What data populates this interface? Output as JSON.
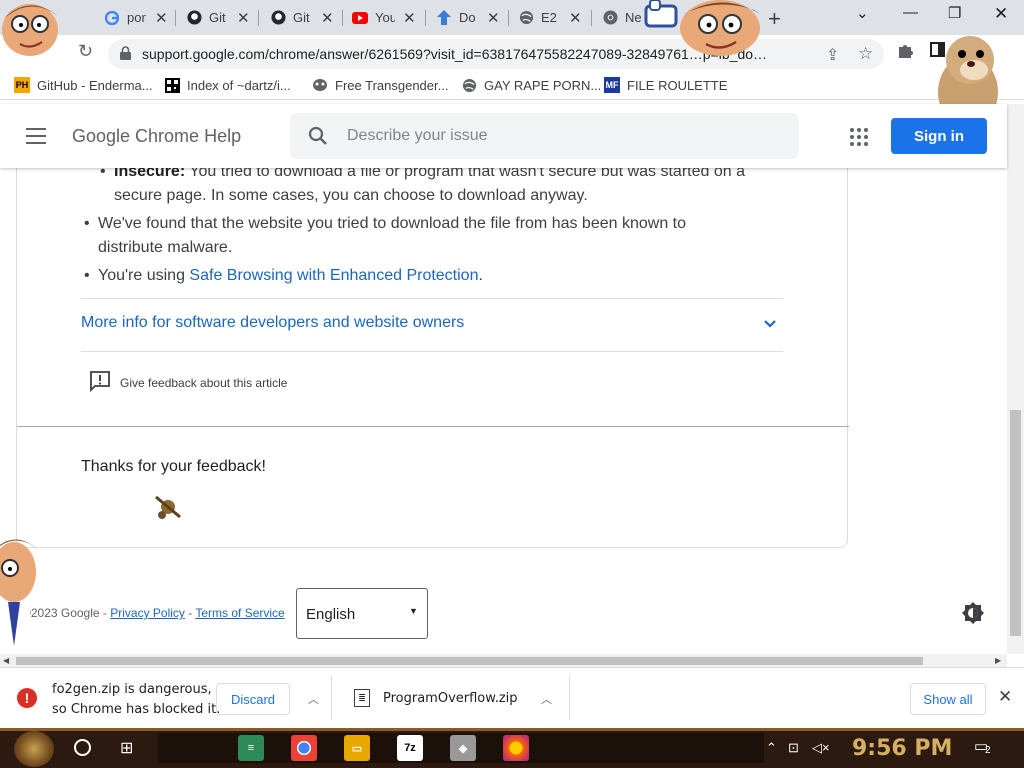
{
  "tabs": [
    {
      "title": "por",
      "favicon": "google-icon"
    },
    {
      "title": "Git",
      "favicon": "github-icon"
    },
    {
      "title": "Git",
      "favicon": "github-icon"
    },
    {
      "title": "You",
      "favicon": "youtube-icon"
    },
    {
      "title": "Do",
      "favicon": "download-arrow-icon"
    },
    {
      "title": "E2",
      "favicon": "globe-icon"
    },
    {
      "title": "Ne",
      "favicon": "chrome-icon"
    }
  ],
  "omnibox": {
    "url": "support.google.com/chrome/answer/6261569?visit_id=638176475582247089-32849761…p=ib_do…"
  },
  "bookmarks": [
    {
      "label": "GitHub - Enderma...",
      "favicon": "PH"
    },
    {
      "label": "Index of ~dartz/i...",
      "favicon": "qr"
    },
    {
      "label": "Free Transgender...",
      "favicon": "mask"
    },
    {
      "label": "GAY RAPE PORN...",
      "favicon": "globe"
    },
    {
      "label": "FILE ROULETTE",
      "favicon": "MF"
    }
  ],
  "help": {
    "title": "Google Chrome Help",
    "search_placeholder": "Describe your issue",
    "signin": "Sign in"
  },
  "article": {
    "insecure_label": "Insecure:",
    "insecure_text": " You tried to download a file or program that wasn't secure but was started on a",
    "insecure_text2": "secure page. In some cases, you can choose to download anyway.",
    "malware_line1": "We've found that the website you tried to download the file from has been known to",
    "malware_line2": "distribute malware.",
    "safe_prefix": "You're using ",
    "safe_link": "Safe Browsing with Enhanced Protection",
    "safe_suffix": ".",
    "more_info": "More info for software developers and website owners",
    "feedback": "Give feedback about this article",
    "thanks": "Thanks for your feedback!"
  },
  "footer": {
    "copyright": "©2023 Google - ",
    "privacy": "Privacy Policy",
    "sep": " - ",
    "terms": "Terms of Service",
    "language": "English"
  },
  "downloads": {
    "warning_line1": "fo2gen.zip is dangerous,",
    "warning_line2": "so Chrome has blocked it.",
    "discard": "Discard",
    "file2": "ProgramOverflow.zip",
    "show_all": "Show all"
  },
  "taskbar": {
    "clock": "9:56 PM",
    "notification_count": "2"
  },
  "colors": {
    "accent": "#1a73e8",
    "danger": "#d93025",
    "link": "#1a66c6"
  }
}
